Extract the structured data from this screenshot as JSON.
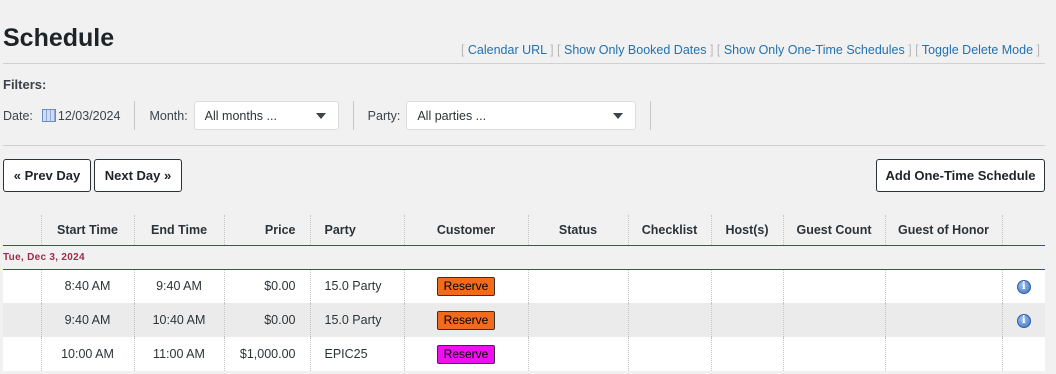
{
  "header": {
    "title": "Schedule",
    "links": [
      {
        "label": "Calendar URL"
      },
      {
        "label": "Show Only Booked Dates"
      },
      {
        "label": "Show Only One-Time Schedules"
      },
      {
        "label": "Toggle Delete Mode"
      }
    ]
  },
  "filters": {
    "heading": "Filters:",
    "date_label": "Date:",
    "date_value": "12/03/2024",
    "month_label": "Month:",
    "month_value": "All months ...",
    "party_label": "Party:",
    "party_value": "All parties ..."
  },
  "nav": {
    "prev_label": "« Prev Day",
    "next_label": "Next Day »",
    "add_label": "Add One-Time Schedule"
  },
  "table": {
    "columns": [
      "",
      "Start Time",
      "End Time",
      "Price",
      "Party",
      "Customer",
      "Status",
      "Checklist",
      "Host(s)",
      "Guest Count",
      "Guest of Honor",
      ""
    ],
    "date_group": "Tue, Dec 3, 2024",
    "rows": [
      {
        "start": "8:40 AM",
        "end": "9:40 AM",
        "price": "$0.00",
        "party": "15.0 Party",
        "customer": "Reserve",
        "customer_color": "#f26a1b",
        "info_icon": "info-icon"
      },
      {
        "start": "9:40 AM",
        "end": "10:40 AM",
        "price": "$0.00",
        "party": "15.0 Party",
        "customer": "Reserve",
        "customer_color": "#f26a1b",
        "info_icon": "info-icon"
      },
      {
        "start": "10:00 AM",
        "end": "11:00 AM",
        "price": "$1,000.00",
        "party": "EPIC25",
        "customer": "Reserve",
        "customer_color": "#ee10ee",
        "info_icon": ""
      }
    ]
  },
  "colors": {
    "link": "#2271b1",
    "date_group": "#9b2c4b",
    "header_rule": "#3d4f7c"
  }
}
